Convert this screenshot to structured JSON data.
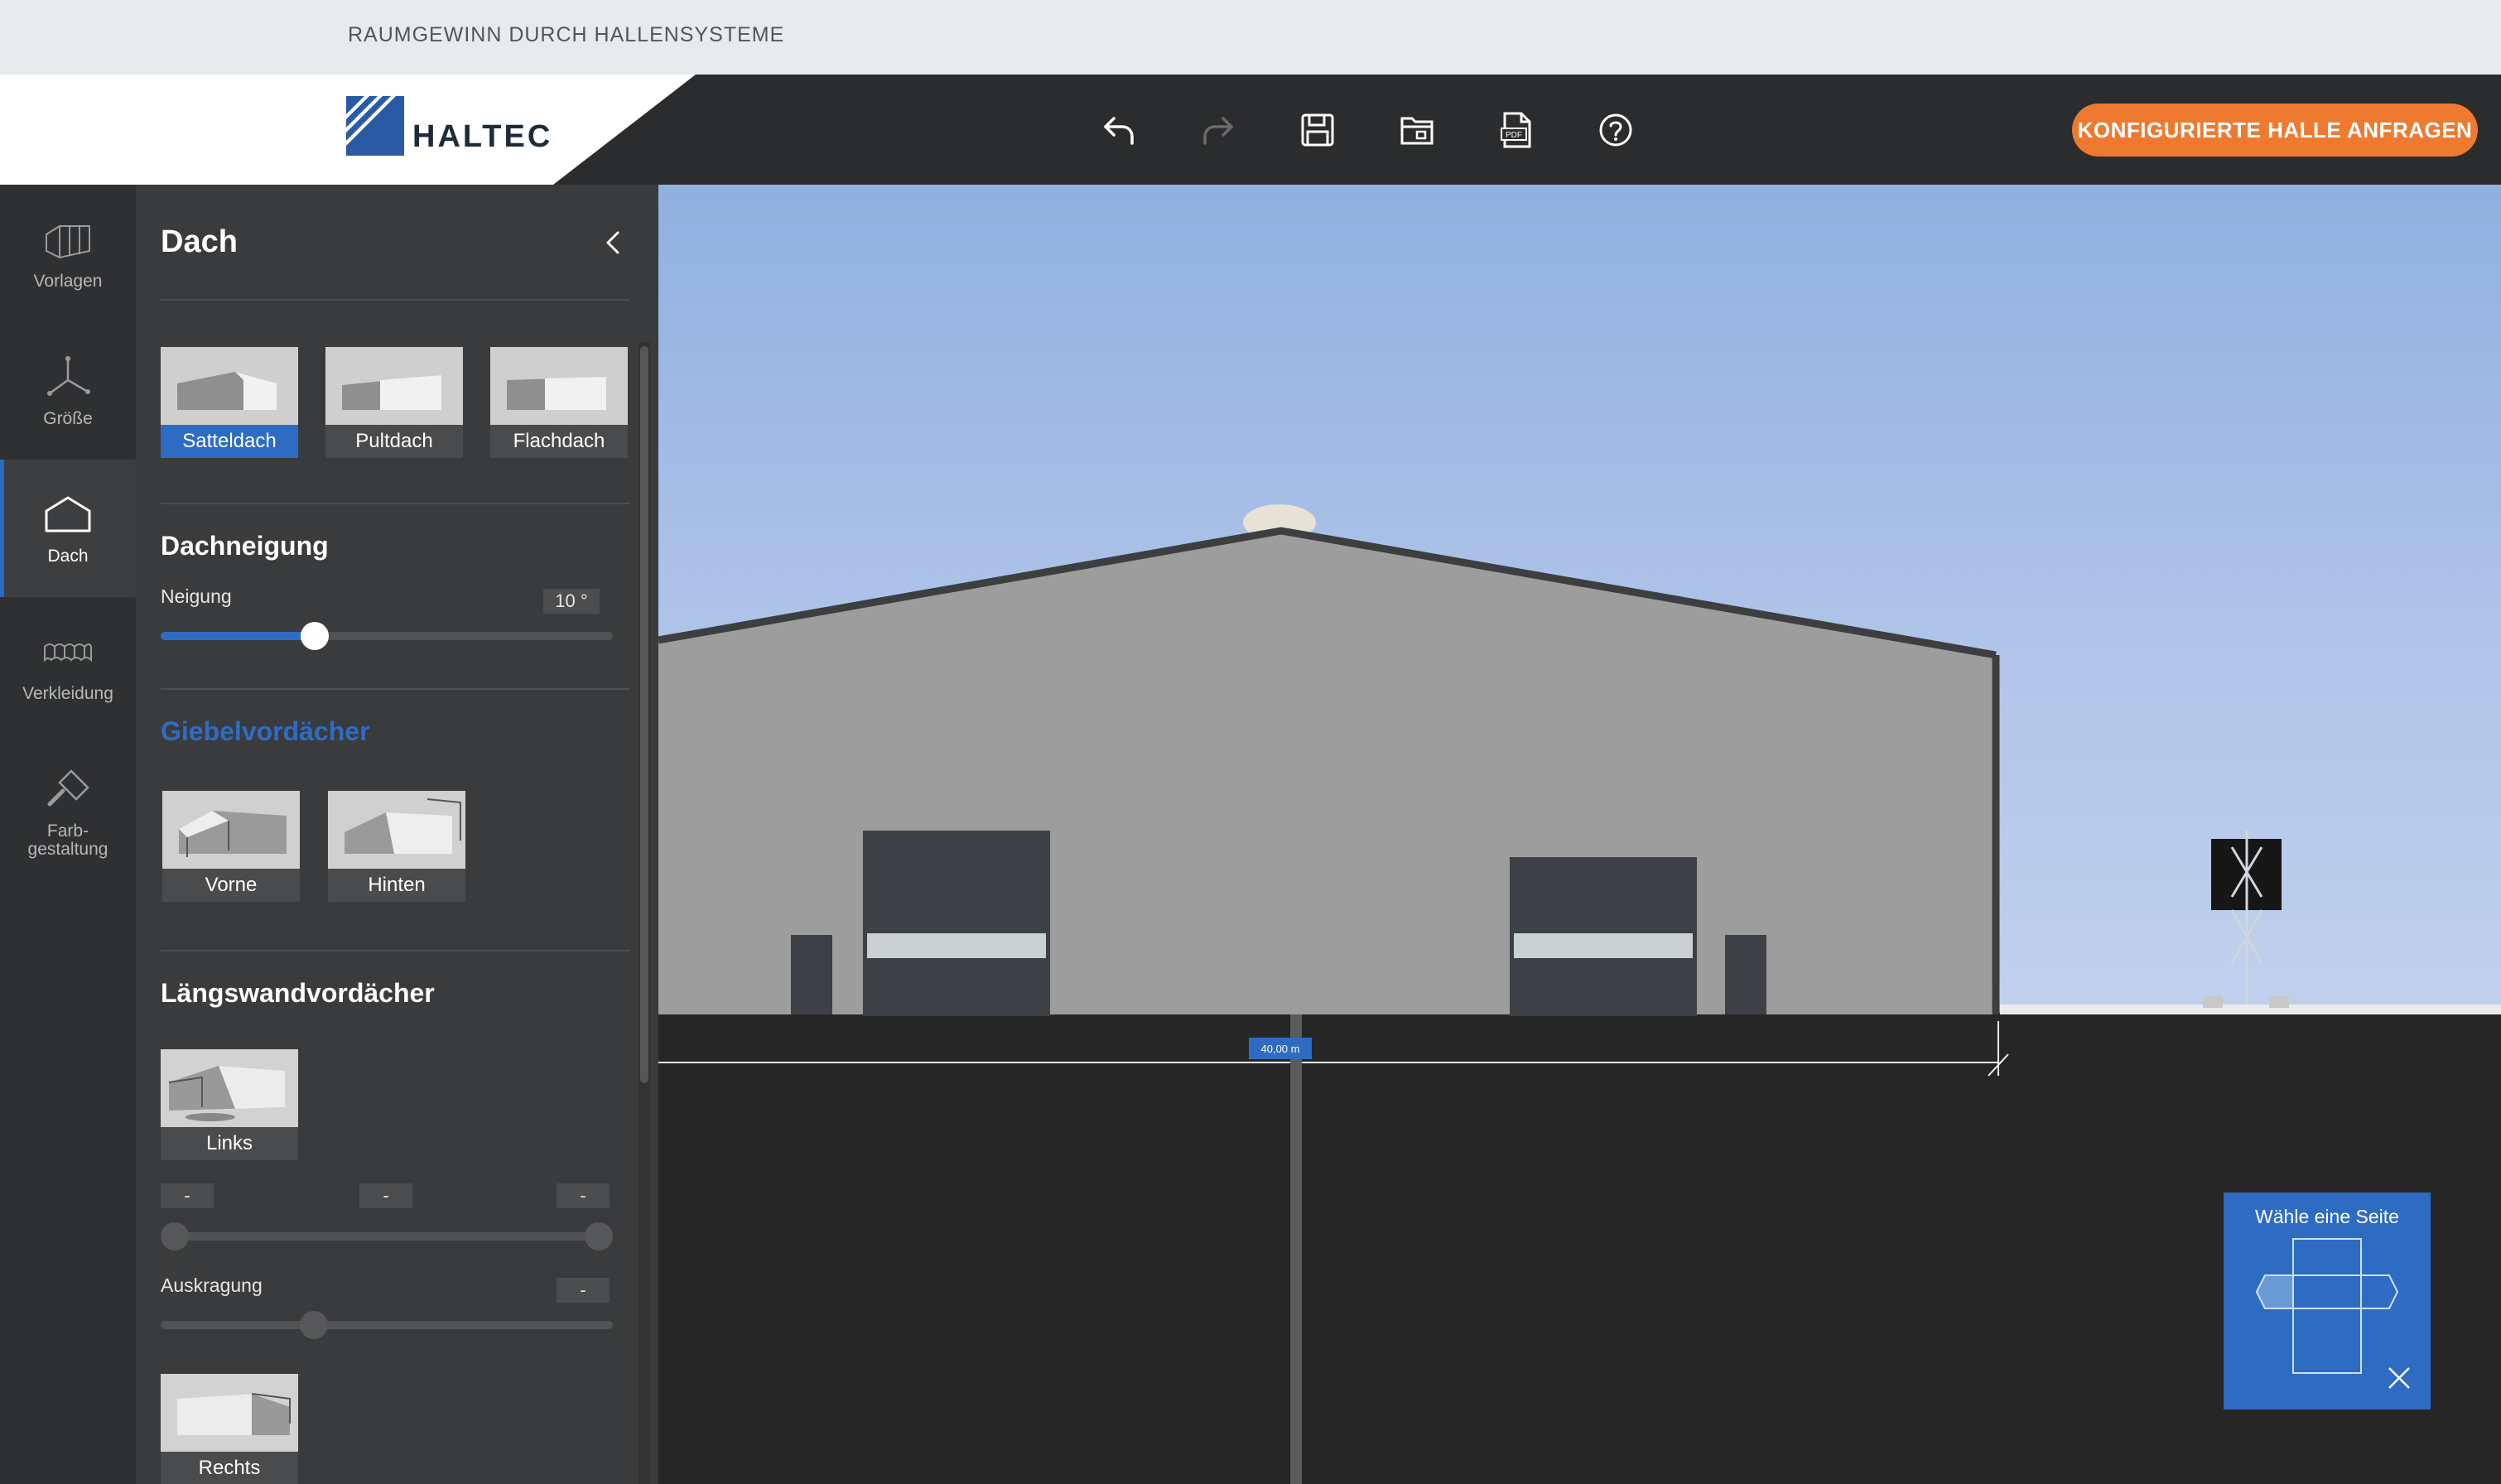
{
  "top_strip": {
    "tagline": "RAUMGEWINN DURCH HALLENSYSTEME"
  },
  "header": {
    "brand": "HALTEC",
    "toolbar": [
      "undo-icon",
      "redo-icon",
      "save-icon",
      "open-file-icon",
      "pdf-export-icon",
      "help-icon"
    ],
    "cta_label": "KONFIGURIERTE HALLE ANFRAGEN",
    "cta_color": "#ee7a30"
  },
  "iconbar": {
    "items": [
      {
        "label": "Vorlagen",
        "icon": "hall-template-icon"
      },
      {
        "label": "Größe",
        "icon": "dimensions-axes-icon"
      },
      {
        "label": "Dach",
        "icon": "roof-house-icon",
        "active": true
      },
      {
        "label": "Verkleidung",
        "icon": "cladding-icon"
      },
      {
        "label": "Farb-",
        "label2": "gestaltung",
        "icon": "paint-roller-icon"
      }
    ]
  },
  "panel": {
    "title": "Dach",
    "roof_types": [
      {
        "label": "Satteldach",
        "selected": true
      },
      {
        "label": "Pultdach"
      },
      {
        "label": "Flachdach"
      }
    ],
    "dachneigung": {
      "heading": "Dachneigung",
      "label": "Neigung",
      "value": "10 °",
      "level_percent": 34
    },
    "giebel": {
      "heading": "Giebelvordächer",
      "options": [
        {
          "label": "Vorne"
        },
        {
          "label": "Hinten"
        }
      ]
    },
    "laengswand": {
      "heading": "Längswandvordächer",
      "links_label": "Links",
      "range_values": [
        "-",
        "-",
        "-"
      ],
      "auskragung_label": "Auskragung",
      "auskragung_value": "-",
      "rechts_label": "Rechts"
    }
  },
  "viewport": {
    "dimension_label": "40,00 m",
    "side_picker_title": "Wähle eine Seite"
  },
  "colors": {
    "accent": "#2e6cc4",
    "dark_bg": "#2f3031"
  }
}
